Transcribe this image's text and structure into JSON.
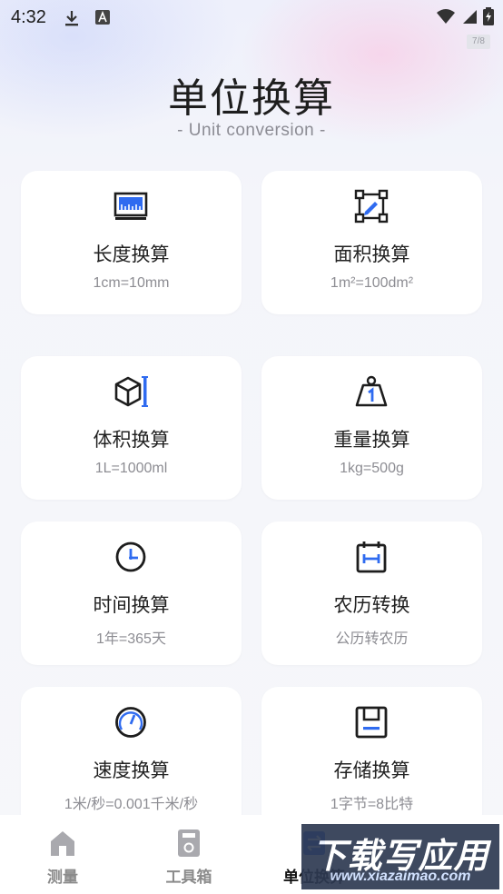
{
  "status_bar": {
    "time": "4:32"
  },
  "ratio_badge": "7/8",
  "header": {
    "title": "单位换算",
    "subtitle": "- Unit conversion -"
  },
  "cards": [
    {
      "name": "长度换算",
      "desc": "1cm=10mm",
      "icon": "ruler-icon"
    },
    {
      "name": "面积换算",
      "desc": "1m²=100dm²",
      "icon": "area-icon"
    },
    {
      "name": "体积换算",
      "desc": "1L=1000ml",
      "icon": "cube-icon"
    },
    {
      "name": "重量换算",
      "desc": "1kg=500g",
      "icon": "weight-icon"
    },
    {
      "name": "时间换算",
      "desc": "1年=365天",
      "icon": "clock-icon"
    },
    {
      "name": "农历转换",
      "desc": "公历转农历",
      "icon": "calendar-icon"
    },
    {
      "name": "速度换算",
      "desc": "1米/秒=0.001千米/秒",
      "icon": "speedometer-icon"
    },
    {
      "name": "存储换算",
      "desc": "1字节=8比特",
      "icon": "floppy-disk-icon"
    }
  ],
  "tabs": [
    {
      "label": "测量",
      "icon": "home-icon",
      "active": false
    },
    {
      "label": "工具箱",
      "icon": "toolbox-icon",
      "active": false
    },
    {
      "label": "单位换算",
      "icon": "convert-icon",
      "active": true
    }
  ],
  "watermark": {
    "text": "下载写应用",
    "url": "www.xiazaimao.com"
  },
  "colors": {
    "accent": "#2f6bf0",
    "text": "#222222",
    "muted": "#8d8d93",
    "card_bg": "#ffffff"
  }
}
